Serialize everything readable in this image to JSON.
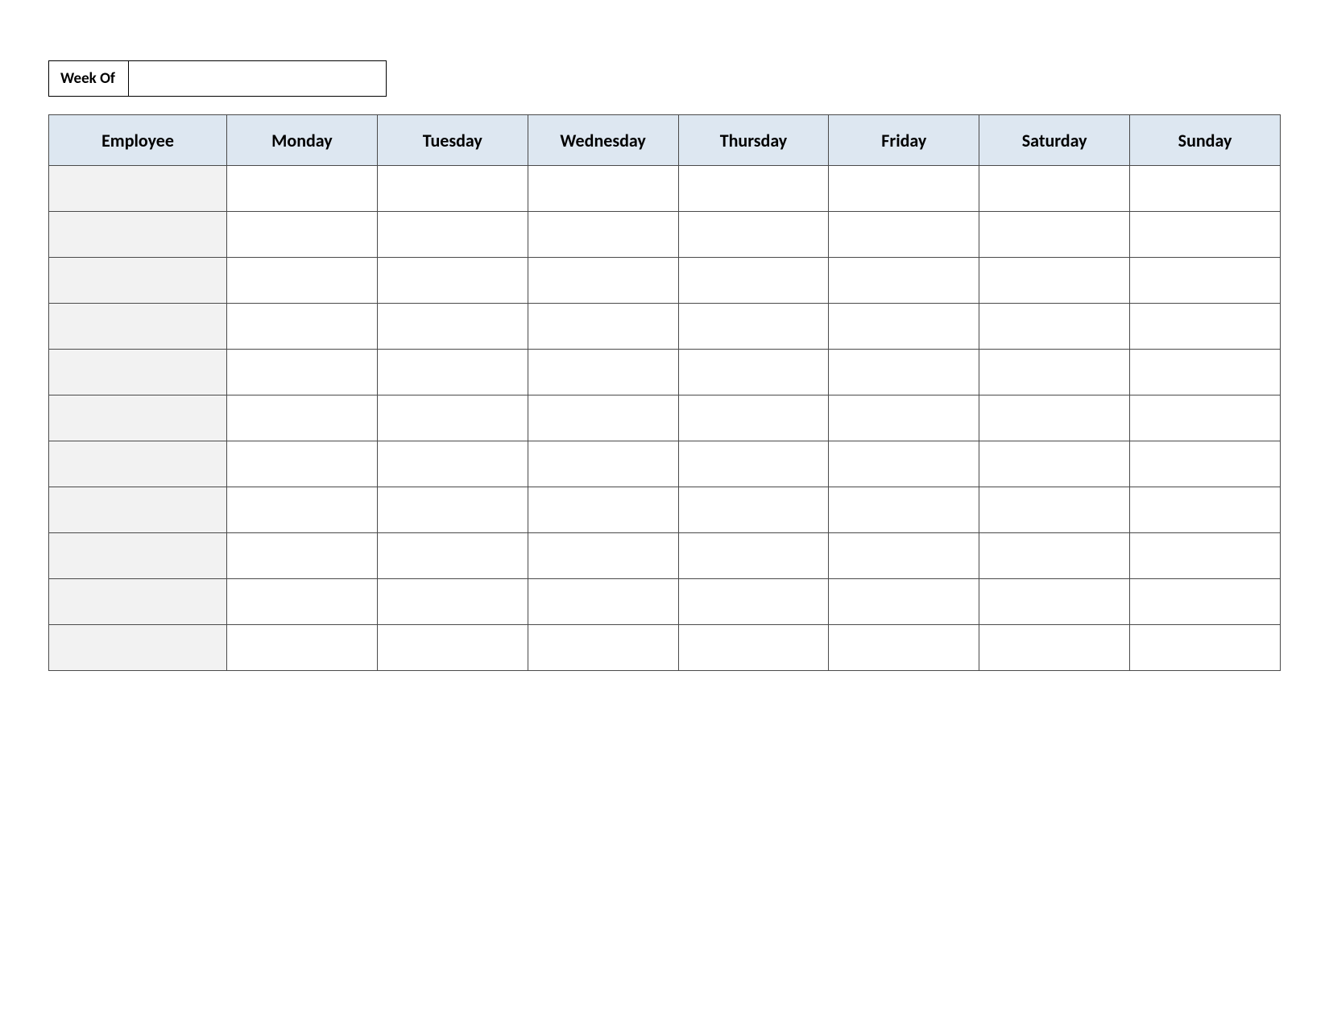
{
  "week_of": {
    "label": "Week Of",
    "value": ""
  },
  "table": {
    "headers": {
      "employee": "Employee",
      "days": [
        "Monday",
        "Tuesday",
        "Wednesday",
        "Thursday",
        "Friday",
        "Saturday",
        "Sunday"
      ]
    },
    "rows": [
      {
        "employee": "",
        "cells": [
          "",
          "",
          "",
          "",
          "",
          "",
          ""
        ]
      },
      {
        "employee": "",
        "cells": [
          "",
          "",
          "",
          "",
          "",
          "",
          ""
        ]
      },
      {
        "employee": "",
        "cells": [
          "",
          "",
          "",
          "",
          "",
          "",
          ""
        ]
      },
      {
        "employee": "",
        "cells": [
          "",
          "",
          "",
          "",
          "",
          "",
          ""
        ]
      },
      {
        "employee": "",
        "cells": [
          "",
          "",
          "",
          "",
          "",
          "",
          ""
        ]
      },
      {
        "employee": "",
        "cells": [
          "",
          "",
          "",
          "",
          "",
          "",
          ""
        ]
      },
      {
        "employee": "",
        "cells": [
          "",
          "",
          "",
          "",
          "",
          "",
          ""
        ]
      },
      {
        "employee": "",
        "cells": [
          "",
          "",
          "",
          "",
          "",
          "",
          ""
        ]
      },
      {
        "employee": "",
        "cells": [
          "",
          "",
          "",
          "",
          "",
          "",
          ""
        ]
      },
      {
        "employee": "",
        "cells": [
          "",
          "",
          "",
          "",
          "",
          "",
          ""
        ]
      },
      {
        "employee": "",
        "cells": [
          "",
          "",
          "",
          "",
          "",
          "",
          ""
        ]
      }
    ]
  }
}
